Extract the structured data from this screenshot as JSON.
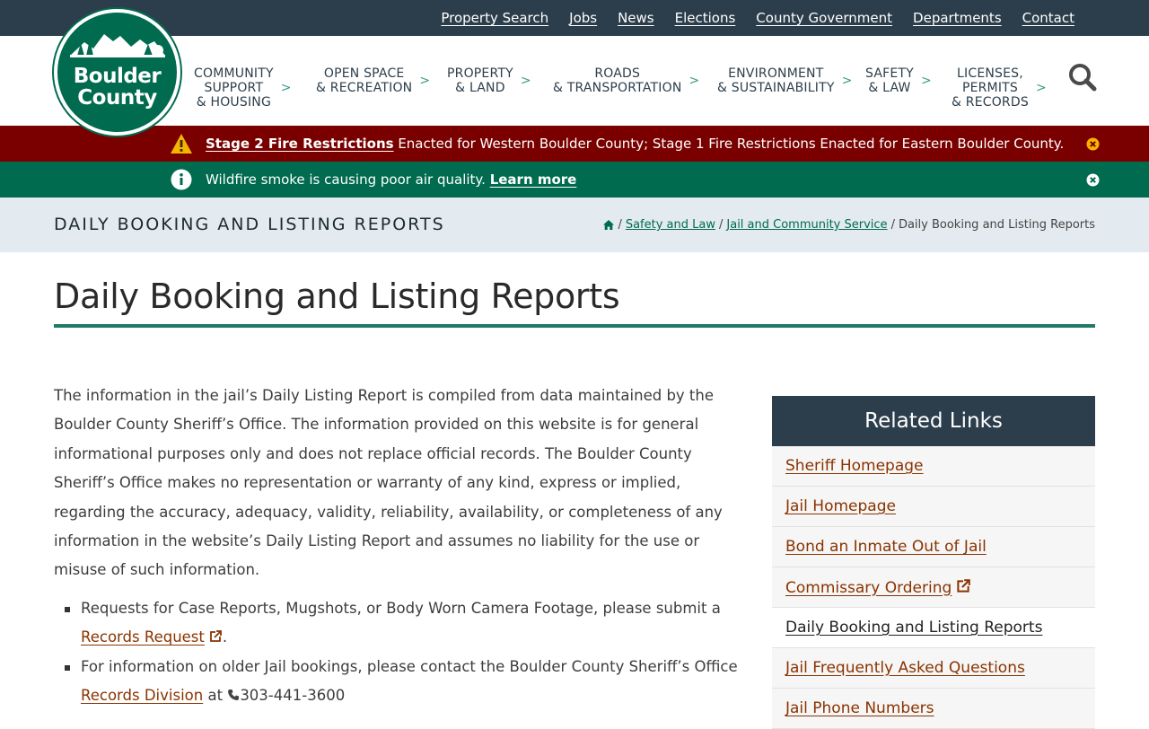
{
  "topnav": [
    "Property Search",
    "Jobs",
    "News",
    "Elections",
    "County Government",
    "Departments",
    "Contact"
  ],
  "logo": {
    "line1": "Boulder",
    "line2": "County"
  },
  "mainnav": [
    {
      "label": "Community Support & Housing"
    },
    {
      "label": "Open Space & Recreation"
    },
    {
      "label": "Property & Land"
    },
    {
      "label": "Roads & Transportation"
    },
    {
      "label": "Environment & Sustainability"
    },
    {
      "label": "Safety & Law"
    },
    {
      "label": "Licenses, Permits & Records"
    }
  ],
  "alerts": {
    "fire": {
      "link": "Stage 2 Fire Restrictions",
      "text": " Enacted for Western Boulder County; Stage 1 Fire Restrictions Enacted for Eastern Boulder County."
    },
    "smoke": {
      "text": "Wildfire smoke is causing poor air quality. ",
      "link": "Learn more"
    }
  },
  "titlebar": {
    "heading": "Daily Booking and Listing Reports"
  },
  "breadcrumb": {
    "sep": "/",
    "items": [
      "Safety and Law",
      "Jail and Community Service"
    ],
    "current": "Daily Booking and Listing Reports"
  },
  "page": {
    "title": "Daily Booking and Listing Reports",
    "intro": "The information in the jail’s Daily Listing Report is compiled from data maintained by the Boulder County Sheriff’s Office. The information provided on this website is for general informational purposes only and does not replace official records. The Boulder County Sheriff’s Office makes no representation or warranty of any kind, express or implied, regarding the accuracy, adequacy, validity, reliability, availability, or completeness of any information in the website’s Daily Listing Report and assumes no liability for the use or misuse of such information.",
    "bullet1": {
      "text": "Requests for Case Reports, Mugshots, or Body Worn Camera Footage, please submit a ",
      "link": "Records Request",
      "after": "."
    },
    "bullet2": {
      "text": "For information on older Jail bookings, please contact the Boulder County Sheriff’s Office ",
      "link": "Records Division",
      "mid": " at ",
      "phone": "303-441-3600"
    }
  },
  "related": {
    "heading": "Related Links",
    "links": [
      "Sheriff Homepage",
      "Jail Homepage",
      "Bond an Inmate Out of Jail",
      "Commissary Ordering",
      "Daily Booking and Listing Reports",
      "Jail Frequently Asked Questions",
      "Jail Phone Numbers"
    ]
  },
  "colors": {
    "brand_green": "#006b4f",
    "navy": "#2c3e4c",
    "alert_red": "#7a0000",
    "link_rust": "#8a3300"
  }
}
